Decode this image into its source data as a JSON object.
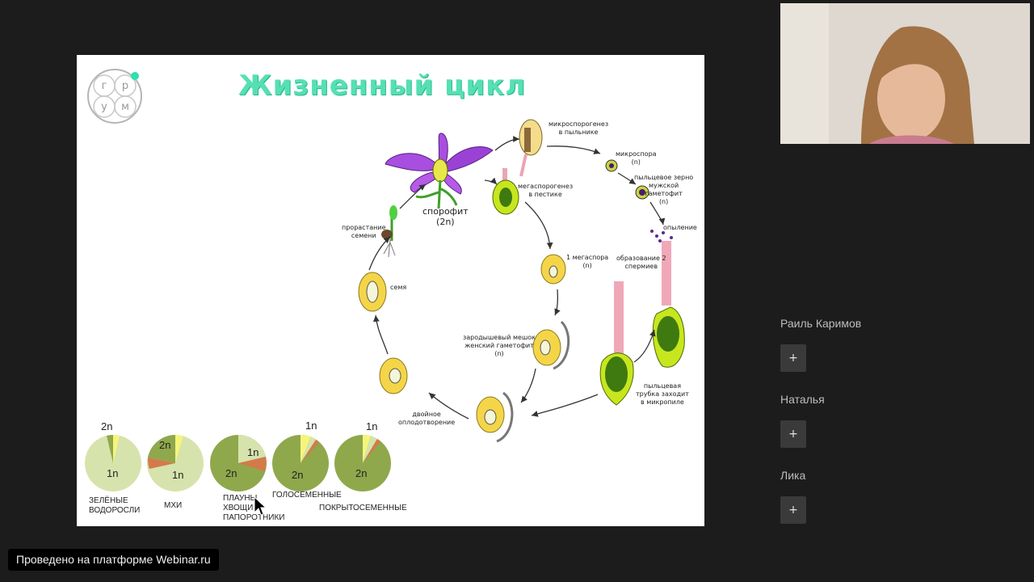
{
  "slide": {
    "logo": {
      "letters": [
        "г",
        "р",
        "у",
        "м"
      ]
    },
    "title": "Жизненный цикл",
    "labels": {
      "sporophyte": "спорофит\n(2n)",
      "microsporogenesis": "микроспорогенез\nв пыльнике",
      "microspore": "микроспора\n(n)",
      "pollen_grain": "пыльцевое зерно\nмужской\nгаметофит\n(n)",
      "pollination": "опыление",
      "sperm_formation": "образование 2\nспермиев",
      "megasporogenesis": "мегаспорогенез\nв пестике",
      "one_megaspore": "1 мегаспора\n(n)",
      "embryo_sac": "зародышевый мешок\nженский гаметофит\n(n)",
      "pollen_tube": "пыльцевая\nтрубка заходит\nв микропиле",
      "double_fertilization": "двойное\nоплодотворение",
      "seed": "семя",
      "germination": "прорастание\nсемени"
    },
    "pies": [
      {
        "top_label": "2n",
        "inner_label": "1n",
        "caption": "ЗЕЛЁНЫЕ\nВОДОРОСЛИ"
      },
      {
        "inner_top": "2n",
        "inner_label": "1n",
        "caption": "МХИ"
      },
      {
        "inner_top": "1n",
        "inner_label": "2n",
        "caption": "ПЛАУНЫ\nХВОЩИ\nПАПОРОТНИКИ"
      },
      {
        "top_label": "1n",
        "inner_label": "2n",
        "caption": "ГОЛОСЕМЕННЫЕ"
      },
      {
        "top_label": "1n",
        "inner_label": "2n",
        "caption": "ПОКРЫТОСЕМЕННЫЕ"
      }
    ]
  },
  "participants": [
    {
      "name": "Раиль Каримов",
      "button": "+"
    },
    {
      "name": "Наталья",
      "button": "+"
    },
    {
      "name": "Лика",
      "button": "+"
    }
  ],
  "footer": {
    "text": "Проведено на платформе Webinar.ru"
  },
  "colors": {
    "title": "#55e0b4",
    "background": "#1c1c1c",
    "pie_green": "#8fa84c",
    "pie_light": "#d6e3ad",
    "flower": "#a84ee0"
  }
}
